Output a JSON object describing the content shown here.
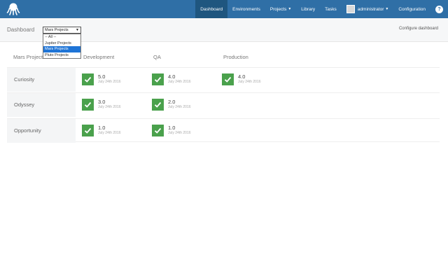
{
  "nav": {
    "items": [
      {
        "label": "Dashboard",
        "active": true
      },
      {
        "label": "Environments"
      },
      {
        "label": "Projects",
        "dropdown": true
      },
      {
        "label": "Library"
      },
      {
        "label": "Tasks"
      }
    ],
    "user": "administrator",
    "configuration": "Configuration",
    "help": "?"
  },
  "subheader": {
    "breadcrumb": "Dashboard",
    "select_value": "Mars Projects",
    "options": [
      "-- All --",
      "Jupiter Projects",
      "Mars Projects",
      "Pluto Projects"
    ],
    "selected_index": 2,
    "configure_link": "Configure dashboard"
  },
  "dashboard": {
    "group_label": "Mars Projects",
    "environments": [
      "Development",
      "QA",
      "Production"
    ],
    "rows": [
      {
        "project": "Curiosity",
        "cells": [
          {
            "version": "5.0",
            "date": "July 24th 2016"
          },
          {
            "version": "4.0",
            "date": "July 24th 2016"
          },
          {
            "version": "4.0",
            "date": "July 24th 2016"
          }
        ]
      },
      {
        "project": "Odyssey",
        "cells": [
          {
            "version": "3.0",
            "date": "July 24th 2016"
          },
          {
            "version": "2.0",
            "date": "July 24th 2016"
          }
        ]
      },
      {
        "project": "Opportunity",
        "cells": [
          {
            "version": "1.0",
            "date": "July 24th 2016"
          },
          {
            "version": "1.0",
            "date": "July 24th 2016"
          }
        ]
      }
    ]
  },
  "colors": {
    "topbar": "#2f6fa6",
    "nav_active": "#1f567f",
    "success": "#4aa14c",
    "select_highlight": "#1e74d6"
  }
}
